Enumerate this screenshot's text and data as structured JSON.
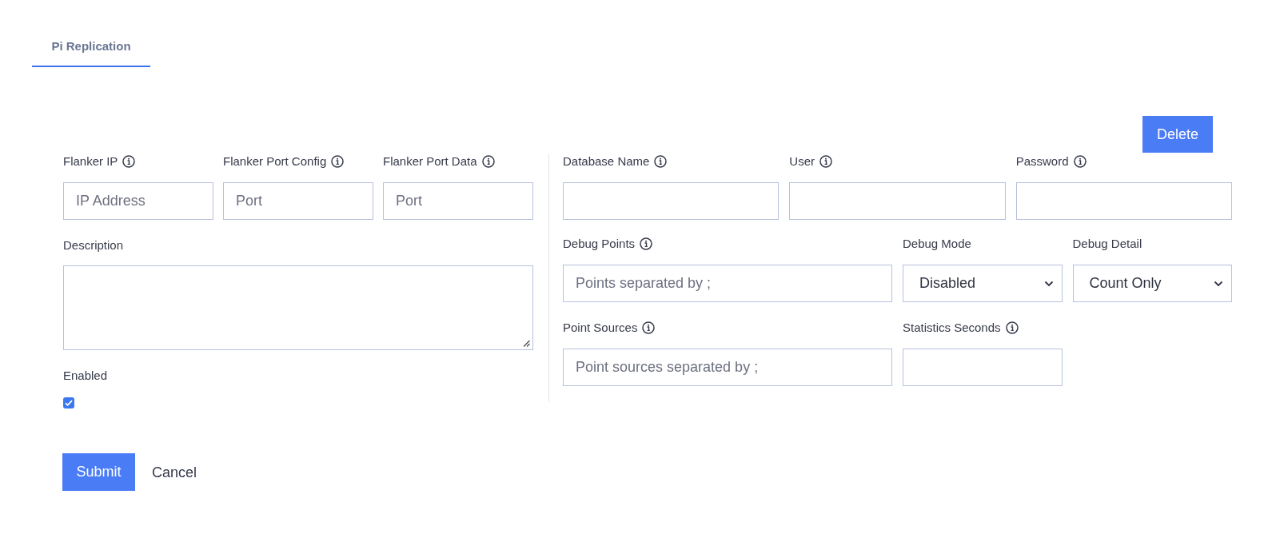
{
  "tabs": [
    {
      "label": "Pi Replication",
      "selected": true
    }
  ],
  "delete_button": {
    "label": "Delete"
  },
  "connection_fields": [
    {
      "label": "Flanker IP",
      "info": true,
      "placeholder": "IP Address"
    },
    {
      "label": "Flanker Port Config",
      "info": true,
      "placeholder": "Port"
    },
    {
      "label": "Flanker Port Data",
      "info": true,
      "placeholder": "Port"
    }
  ],
  "description": {
    "label": "Description"
  },
  "enabled": {
    "label": "Enabled",
    "checked": true
  },
  "database_rows": [
    [
      {
        "kind": "text",
        "label": "Database Name",
        "info": true
      },
      {
        "kind": "text",
        "label": "User",
        "info": true
      },
      {
        "kind": "text",
        "label": "Password",
        "info": true
      }
    ],
    [
      {
        "kind": "text",
        "label": "Debug Points",
        "info": true,
        "placeholder": "Points separated by ;"
      },
      {
        "kind": "select",
        "label": "Debug Mode",
        "info": false,
        "value": "Disabled"
      },
      {
        "kind": "select",
        "label": "Debug Detail",
        "info": false,
        "value": "Count Only"
      }
    ],
    [
      {
        "kind": "text",
        "label": "Point Sources",
        "info": true,
        "placeholder": "Point sources separated by ;"
      },
      {
        "kind": "text",
        "label": "Statistics Seconds",
        "info": true
      }
    ]
  ],
  "actions": [
    {
      "kind": "primary",
      "label": "Submit"
    },
    {
      "kind": "link",
      "label": "Cancel"
    }
  ]
}
